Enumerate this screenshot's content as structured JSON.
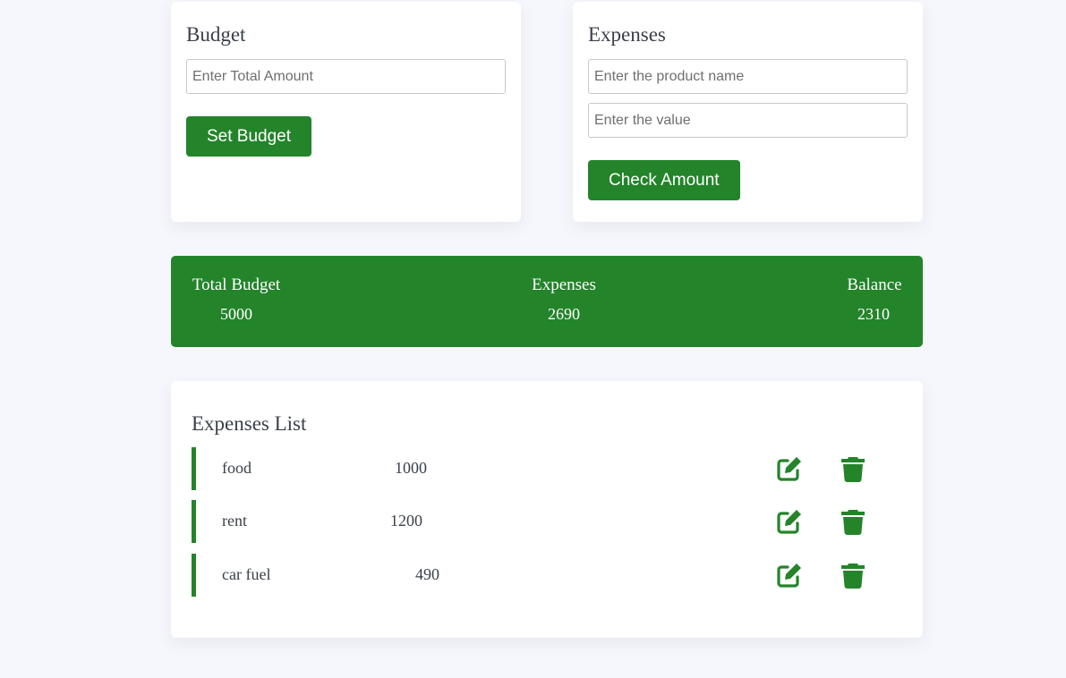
{
  "budget": {
    "title": "Budget",
    "amount_placeholder": "Enter Total Amount",
    "amount_value": "",
    "set_button": "Set Budget"
  },
  "expenses_form": {
    "title": "Expenses",
    "product_placeholder": "Enter the product name",
    "product_value": "",
    "value_placeholder": "Enter the value",
    "value_value": "",
    "check_button": "Check Amount"
  },
  "summary": {
    "total_label": "Total Budget",
    "total_value": "5000",
    "expenses_label": "Expenses",
    "expenses_value": "2690",
    "balance_label": "Balance",
    "balance_value": "2310"
  },
  "list": {
    "title": "Expenses List",
    "items": [
      {
        "name": "food",
        "value": "1000"
      },
      {
        "name": "rent",
        "value": "1200"
      },
      {
        "name": "car fuel",
        "value": "490"
      }
    ],
    "edit_icon": "edit-icon",
    "delete_icon": "trash-icon"
  },
  "colors": {
    "accent": "#23842a",
    "background": "#f6f7fc",
    "card": "#ffffff",
    "text": "#3a3f4a"
  }
}
